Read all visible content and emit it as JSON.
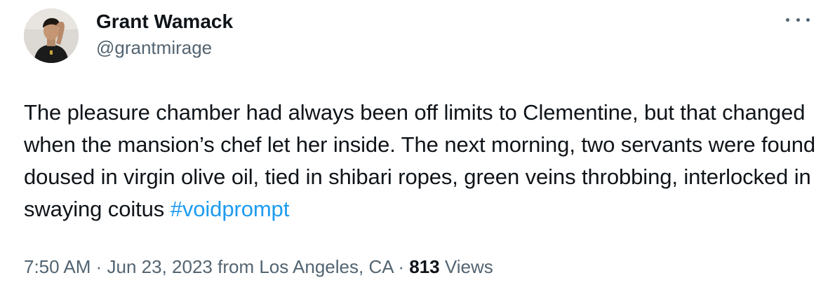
{
  "author": {
    "display_name": "Grant Wamack",
    "handle": "@grantmirage"
  },
  "tweet": {
    "text_before": "The pleasure chamber had always been off limits to Clementine, but that changed when the mansion’s chef let her inside. The next morning, two servants were found doused in virgin olive oil, tied in shibari ropes, green veins throbbing, interlocked in swaying coitus ",
    "hashtag": "#voidprompt"
  },
  "meta": {
    "time": "7:50 AM",
    "sep1": " · ",
    "date": "Jun 23, 2023",
    "from_label": " from ",
    "location": "Los Angeles, CA",
    "sep2": " · ",
    "views_count": "813",
    "views_label": " Views"
  },
  "icons": {
    "more": "more-horizontal-icon",
    "avatar": "avatar"
  },
  "colors": {
    "link": "#1d9bf0",
    "secondary_text": "#536471",
    "primary_text": "#0f1419"
  }
}
